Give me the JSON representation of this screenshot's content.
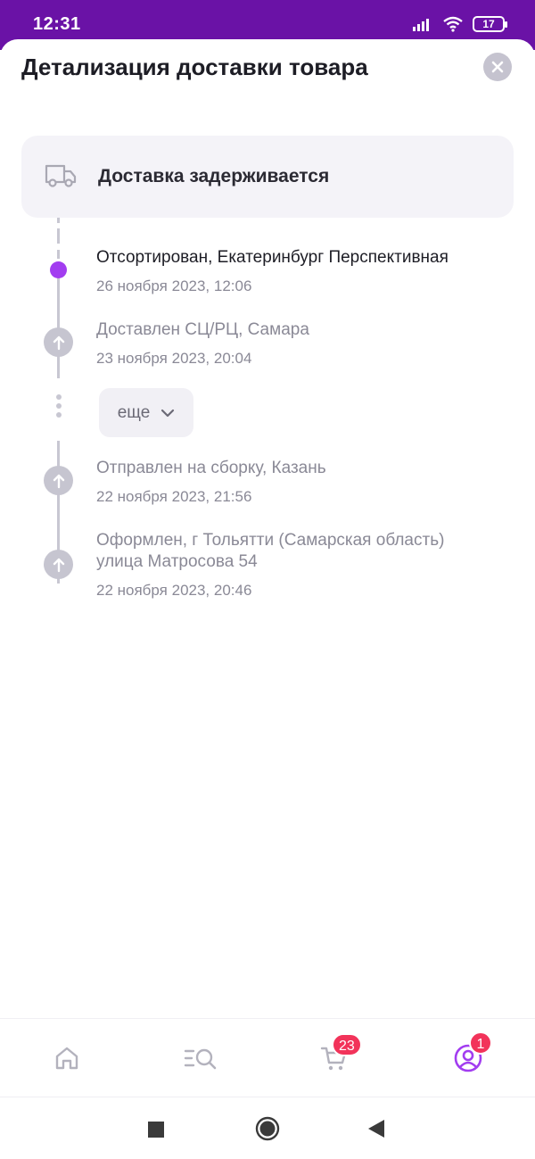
{
  "status_bar": {
    "time": "12:31",
    "battery": "17"
  },
  "sheet": {
    "title": "Детализация доставки товара",
    "status_card": {
      "icon": "truck-icon",
      "text": "Доставка задерживается"
    },
    "events": [
      {
        "title": "Отсортирован, Екатеринбург Перспективная",
        "date": "26 ноября 2023, 12:06",
        "active": true
      },
      {
        "title": "Доставлен СЦ/РЦ, Самара",
        "date": "23 ноября 2023, 20:04",
        "active": false
      },
      {
        "title": "Отправлен на сборку, Казань",
        "date": "22 ноября 2023, 21:56",
        "active": false
      },
      {
        "title_lines": [
          "Оформлен, г Тольятти (Самарская область)",
          "улица Матросова 54"
        ],
        "date": "22 ноября 2023, 20:46",
        "active": false
      }
    ],
    "more_label": "еще"
  },
  "bottom_nav": {
    "items": [
      {
        "icon": "home-icon"
      },
      {
        "icon": "catalog-search-icon"
      },
      {
        "icon": "cart-icon",
        "badge": "23"
      },
      {
        "icon": "profile-icon",
        "badge": "1"
      }
    ]
  },
  "colors": {
    "status_bar": "#6a12a6",
    "accent": "#a23df0",
    "badge": "#f2335a",
    "muted": "#8a8996"
  }
}
